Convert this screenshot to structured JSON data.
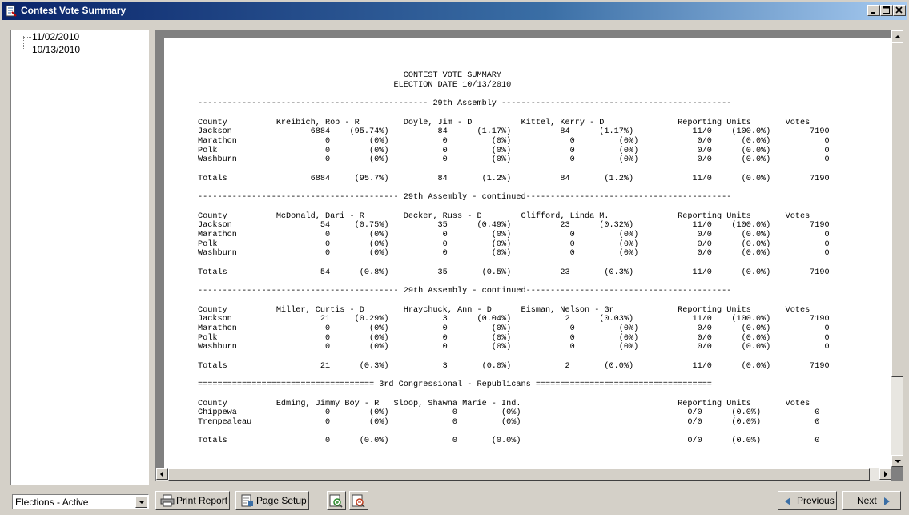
{
  "window": {
    "title": "Contest Vote Summary"
  },
  "tree": {
    "items": [
      {
        "label": "11/02/2010"
      },
      {
        "label": "10/13/2010"
      }
    ]
  },
  "filter": {
    "selected": "Elections - Active"
  },
  "toolbar": {
    "print_label": "Print Report",
    "setup_label": "Page Setup",
    "previous_label": "Previous",
    "next_label": "Next"
  },
  "report": {
    "lines": [
      "                                          CONTEST VOTE SUMMARY",
      "                                        ELECTION DATE 10/13/2010",
      "",
      "----------------------------------------------- 29th Assembly -----------------------------------------------",
      "",
      "County          Kreibich, Rob - R         Doyle, Jim - D          Kittel, Kerry - D               Reporting Units       Votes",
      "Jackson                6884    (95.74%)          84      (1.17%)          84      (1.17%)            11/0    (100.0%)        7190",
      "Marathon                  0        (0%)           0         (0%)            0         (0%)            0/0      (0.0%)           0",
      "Polk                      0        (0%)           0         (0%)            0         (0%)            0/0      (0.0%)           0",
      "Washburn                  0        (0%)           0         (0%)            0         (0%)            0/0      (0.0%)           0",
      "",
      "Totals                 6884     (95.7%)          84       (1.2%)          84       (1.2%)            11/0      (0.0%)        7190",
      "",
      "----------------------------------------- 29th Assembly - continued------------------------------------------",
      "",
      "County          McDonald, Dari - R        Decker, Russ - D        Clifford, Linda M.              Reporting Units       Votes",
      "Jackson                  54     (0.75%)          35      (0.49%)          23      (0.32%)            11/0    (100.0%)        7190",
      "Marathon                  0        (0%)           0         (0%)            0         (0%)            0/0      (0.0%)           0",
      "Polk                      0        (0%)           0         (0%)            0         (0%)            0/0      (0.0%)           0",
      "Washburn                  0        (0%)           0         (0%)            0         (0%)            0/0      (0.0%)           0",
      "",
      "Totals                   54      (0.8%)          35       (0.5%)          23       (0.3%)            11/0      (0.0%)        7190",
      "",
      "----------------------------------------- 29th Assembly - continued------------------------------------------",
      "",
      "County          Miller, Curtis - D        Hraychuck, Ann - D      Eisman, Nelson - Gr             Reporting Units       Votes",
      "Jackson                  21     (0.29%)           3      (0.04%)           2      (0.03%)            11/0    (100.0%)        7190",
      "Marathon                  0        (0%)           0         (0%)            0         (0%)            0/0      (0.0%)           0",
      "Polk                      0        (0%)           0         (0%)            0         (0%)            0/0      (0.0%)           0",
      "Washburn                  0        (0%)           0         (0%)            0         (0%)            0/0      (0.0%)           0",
      "",
      "Totals                   21      (0.3%)           3       (0.0%)           2       (0.0%)            11/0      (0.0%)        7190",
      "",
      "==================================== 3rd Congressional - Republicans ====================================",
      "",
      "County          Edming, Jimmy Boy - R   Sloop, Shawna Marie - Ind.                                Reporting Units       Votes",
      "Chippewa                  0        (0%)             0         (0%)                                  0/0      (0.0%)           0",
      "Trempealeau               0        (0%)             0         (0%)                                  0/0      (0.0%)           0",
      "",
      "Totals                    0      (0.0%)             0       (0.0%)                                  0/0      (0.0%)           0"
    ]
  }
}
